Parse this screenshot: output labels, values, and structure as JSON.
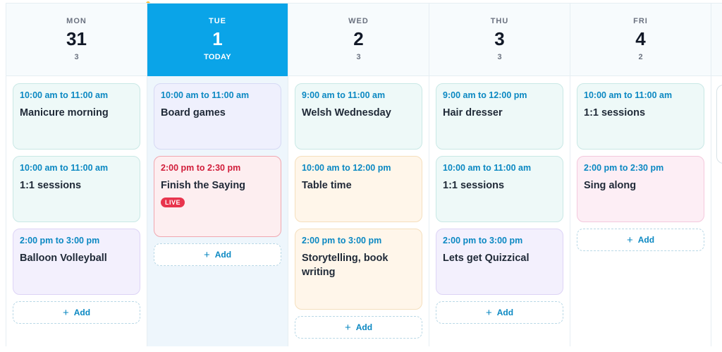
{
  "days": [
    {
      "dow": "MON",
      "day": "31",
      "count": "3",
      "today": false,
      "events": [
        {
          "time": "10:00 am to 11:00 am",
          "title": "Manicure morning",
          "style": "mint"
        },
        {
          "time": "10:00 am to 11:00 am",
          "title": "1:1 sessions",
          "style": "mint"
        },
        {
          "time": "2:00 pm to 3:00 pm",
          "title": "Balloon Volleyball",
          "style": "lav"
        }
      ],
      "add_label": "Add"
    },
    {
      "dow": "TUE",
      "day": "1",
      "count": "TODAY",
      "today": true,
      "events": [
        {
          "time": "10:00 am to 11:00 am",
          "title": "Board games",
          "style": "blue"
        },
        {
          "time": "2:00 pm to 2:30 pm",
          "title": "Finish the Saying",
          "style": "red",
          "badge": "LIVE"
        }
      ],
      "add_label": "Add"
    },
    {
      "dow": "WED",
      "day": "2",
      "count": "3",
      "today": false,
      "events": [
        {
          "time": "9:00 am to 11:00 am",
          "title": "Welsh Wednesday",
          "style": "mint"
        },
        {
          "time": "10:00 am to 12:00 pm",
          "title": "Table time",
          "style": "peach"
        },
        {
          "time": "2:00 pm to 3:00 pm",
          "title": "Storytelling, book writing",
          "style": "peach",
          "tall": true
        }
      ],
      "add_label": "Add"
    },
    {
      "dow": "THU",
      "day": "3",
      "count": "3",
      "today": false,
      "events": [
        {
          "time": "9:00 am to 12:00 pm",
          "title": "Hair dresser",
          "style": "mint"
        },
        {
          "time": "10:00 am to 11:00 am",
          "title": "1:1 sessions",
          "style": "mint"
        },
        {
          "time": "2:00 pm to 3:00 pm",
          "title": "Lets get Quizzical",
          "style": "lav"
        }
      ],
      "add_label": "Add"
    },
    {
      "dow": "FRI",
      "day": "4",
      "count": "2",
      "today": false,
      "events": [
        {
          "time": "10:00 am to 11:00 am",
          "title": "1:1 sessions",
          "style": "mint"
        },
        {
          "time": "2:00 pm to 2:30 pm",
          "title": "Sing along",
          "style": "pink"
        }
      ],
      "add_label": "Add"
    }
  ],
  "icons": {
    "add": "plus-icon"
  },
  "colors": {
    "accent": "#0aa4e8",
    "live": "#e8344d",
    "time_text": "#0b88c2"
  }
}
